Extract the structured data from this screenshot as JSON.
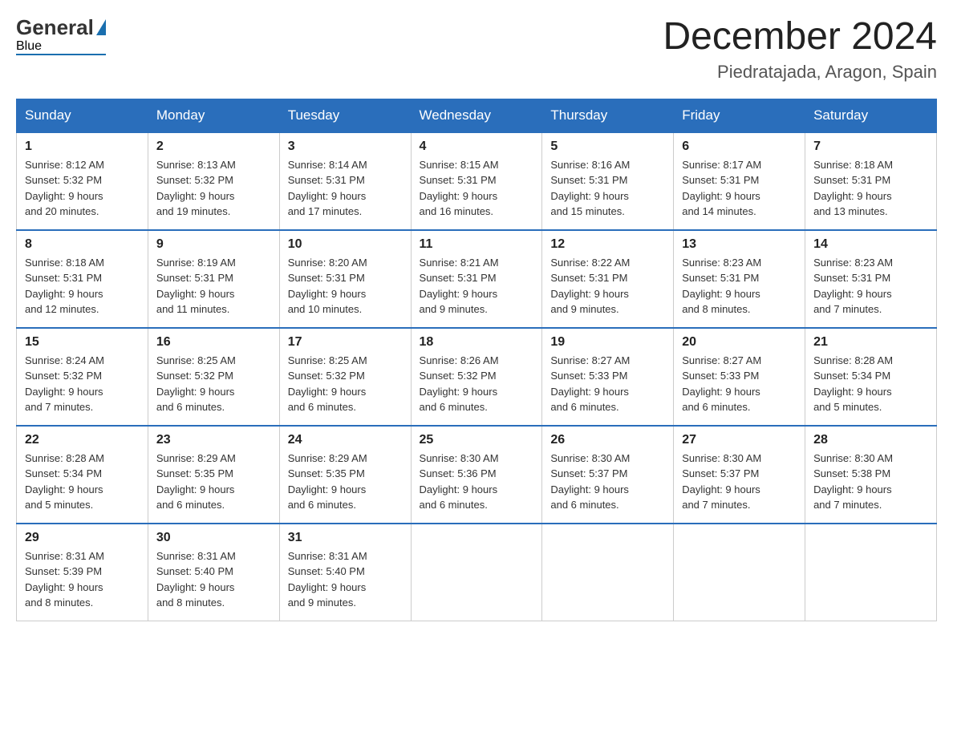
{
  "header": {
    "logo_general": "General",
    "logo_blue": "Blue",
    "month_title": "December 2024",
    "location": "Piedratajada, Aragon, Spain"
  },
  "weekdays": [
    "Sunday",
    "Monday",
    "Tuesday",
    "Wednesday",
    "Thursday",
    "Friday",
    "Saturday"
  ],
  "weeks": [
    [
      {
        "day": "1",
        "sunrise": "8:12 AM",
        "sunset": "5:32 PM",
        "daylight": "9 hours and 20 minutes."
      },
      {
        "day": "2",
        "sunrise": "8:13 AM",
        "sunset": "5:32 PM",
        "daylight": "9 hours and 19 minutes."
      },
      {
        "day": "3",
        "sunrise": "8:14 AM",
        "sunset": "5:31 PM",
        "daylight": "9 hours and 17 minutes."
      },
      {
        "day": "4",
        "sunrise": "8:15 AM",
        "sunset": "5:31 PM",
        "daylight": "9 hours and 16 minutes."
      },
      {
        "day": "5",
        "sunrise": "8:16 AM",
        "sunset": "5:31 PM",
        "daylight": "9 hours and 15 minutes."
      },
      {
        "day": "6",
        "sunrise": "8:17 AM",
        "sunset": "5:31 PM",
        "daylight": "9 hours and 14 minutes."
      },
      {
        "day": "7",
        "sunrise": "8:18 AM",
        "sunset": "5:31 PM",
        "daylight": "9 hours and 13 minutes."
      }
    ],
    [
      {
        "day": "8",
        "sunrise": "8:18 AM",
        "sunset": "5:31 PM",
        "daylight": "9 hours and 12 minutes."
      },
      {
        "day": "9",
        "sunrise": "8:19 AM",
        "sunset": "5:31 PM",
        "daylight": "9 hours and 11 minutes."
      },
      {
        "day": "10",
        "sunrise": "8:20 AM",
        "sunset": "5:31 PM",
        "daylight": "9 hours and 10 minutes."
      },
      {
        "day": "11",
        "sunrise": "8:21 AM",
        "sunset": "5:31 PM",
        "daylight": "9 hours and 9 minutes."
      },
      {
        "day": "12",
        "sunrise": "8:22 AM",
        "sunset": "5:31 PM",
        "daylight": "9 hours and 9 minutes."
      },
      {
        "day": "13",
        "sunrise": "8:23 AM",
        "sunset": "5:31 PM",
        "daylight": "9 hours and 8 minutes."
      },
      {
        "day": "14",
        "sunrise": "8:23 AM",
        "sunset": "5:31 PM",
        "daylight": "9 hours and 7 minutes."
      }
    ],
    [
      {
        "day": "15",
        "sunrise": "8:24 AM",
        "sunset": "5:32 PM",
        "daylight": "9 hours and 7 minutes."
      },
      {
        "day": "16",
        "sunrise": "8:25 AM",
        "sunset": "5:32 PM",
        "daylight": "9 hours and 6 minutes."
      },
      {
        "day": "17",
        "sunrise": "8:25 AM",
        "sunset": "5:32 PM",
        "daylight": "9 hours and 6 minutes."
      },
      {
        "day": "18",
        "sunrise": "8:26 AM",
        "sunset": "5:32 PM",
        "daylight": "9 hours and 6 minutes."
      },
      {
        "day": "19",
        "sunrise": "8:27 AM",
        "sunset": "5:33 PM",
        "daylight": "9 hours and 6 minutes."
      },
      {
        "day": "20",
        "sunrise": "8:27 AM",
        "sunset": "5:33 PM",
        "daylight": "9 hours and 6 minutes."
      },
      {
        "day": "21",
        "sunrise": "8:28 AM",
        "sunset": "5:34 PM",
        "daylight": "9 hours and 5 minutes."
      }
    ],
    [
      {
        "day": "22",
        "sunrise": "8:28 AM",
        "sunset": "5:34 PM",
        "daylight": "9 hours and 5 minutes."
      },
      {
        "day": "23",
        "sunrise": "8:29 AM",
        "sunset": "5:35 PM",
        "daylight": "9 hours and 6 minutes."
      },
      {
        "day": "24",
        "sunrise": "8:29 AM",
        "sunset": "5:35 PM",
        "daylight": "9 hours and 6 minutes."
      },
      {
        "day": "25",
        "sunrise": "8:30 AM",
        "sunset": "5:36 PM",
        "daylight": "9 hours and 6 minutes."
      },
      {
        "day": "26",
        "sunrise": "8:30 AM",
        "sunset": "5:37 PM",
        "daylight": "9 hours and 6 minutes."
      },
      {
        "day": "27",
        "sunrise": "8:30 AM",
        "sunset": "5:37 PM",
        "daylight": "9 hours and 7 minutes."
      },
      {
        "day": "28",
        "sunrise": "8:30 AM",
        "sunset": "5:38 PM",
        "daylight": "9 hours and 7 minutes."
      }
    ],
    [
      {
        "day": "29",
        "sunrise": "8:31 AM",
        "sunset": "5:39 PM",
        "daylight": "9 hours and 8 minutes."
      },
      {
        "day": "30",
        "sunrise": "8:31 AM",
        "sunset": "5:40 PM",
        "daylight": "9 hours and 8 minutes."
      },
      {
        "day": "31",
        "sunrise": "8:31 AM",
        "sunset": "5:40 PM",
        "daylight": "9 hours and 9 minutes."
      },
      null,
      null,
      null,
      null
    ]
  ],
  "labels": {
    "sunrise": "Sunrise:",
    "sunset": "Sunset:",
    "daylight": "Daylight:"
  }
}
